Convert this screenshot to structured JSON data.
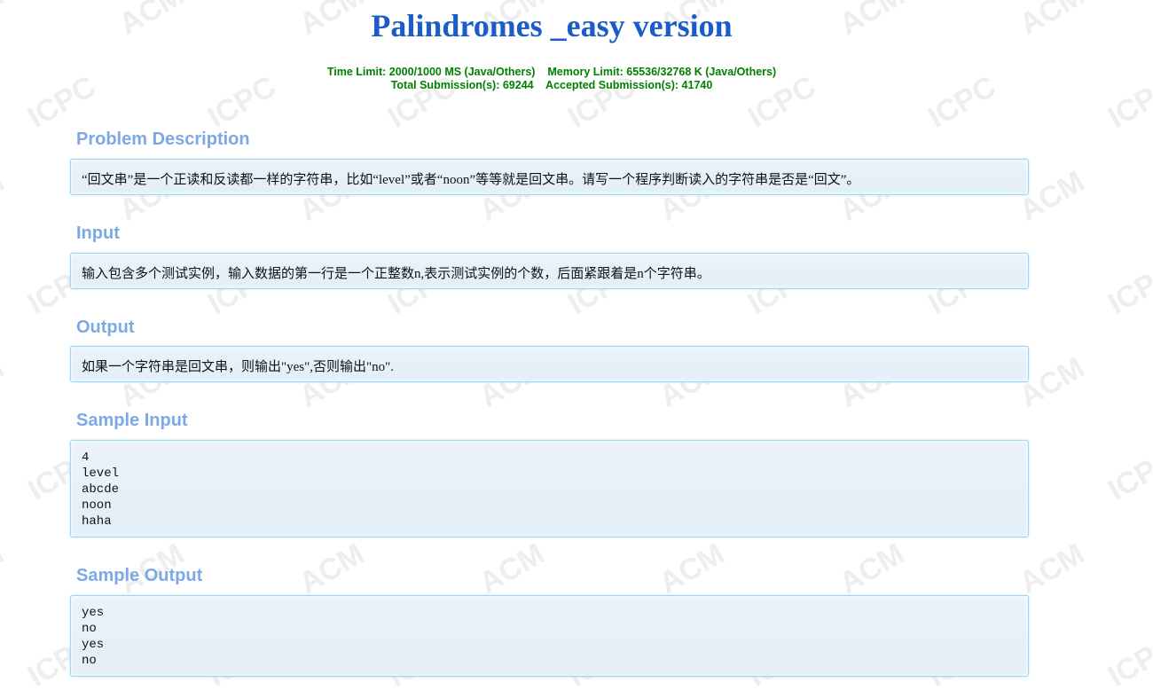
{
  "problem": {
    "title": "Palindromes _easy version",
    "time_limit": "Time Limit: 2000/1000 MS (Java/Others)",
    "memory_limit": "Memory Limit: 65536/32768 K (Java/Others)",
    "total_submissions": "Total Submission(s): 69244",
    "accepted_submissions": "Accepted Submission(s): 41740"
  },
  "sections": {
    "description": {
      "heading": "Problem Description",
      "text": "“回文串”是一个正读和反读都一样的字符串，比如“level”或者“noon”等等就是回文串。请写一个程序判断读入的字符串是否是“回文”。"
    },
    "input": {
      "heading": "Input",
      "text": "输入包含多个测试实例，输入数据的第一行是一个正整数n,表示测试实例的个数，后面紧跟着是n个字符串。"
    },
    "output": {
      "heading": "Output",
      "text": "如果一个字符串是回文串，则输出\"yes\",否则输出\"no\"."
    },
    "sample_input": {
      "heading": "Sample Input",
      "text": "4\nlevel\nabcde\nnoon\nhaha"
    },
    "sample_output": {
      "heading": "Sample Output",
      "text": "yes\nno\nyes\nno"
    }
  },
  "watermark": {
    "words": [
      "ACM",
      "ICPC"
    ],
    "color": "#eeeeee"
  },
  "colors": {
    "title": "#1a5cc8",
    "limits": "#008000",
    "section_heading": "#7ca9e6",
    "panel_border": "#9ed6f5",
    "panel_background": "#e6f0f9"
  }
}
